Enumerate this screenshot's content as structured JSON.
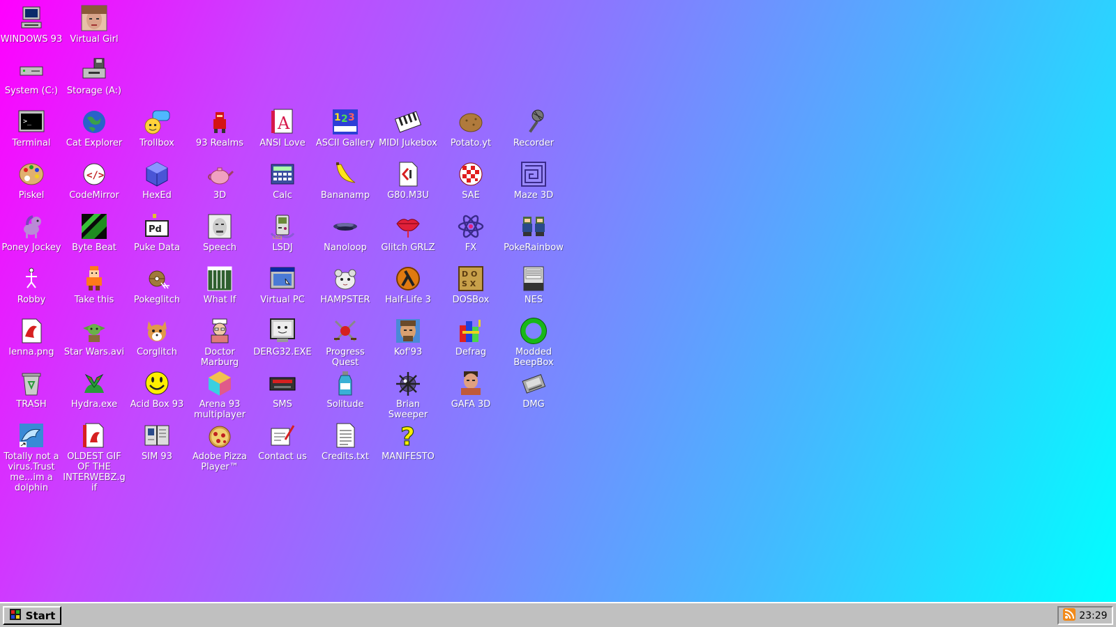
{
  "desktop": {
    "background_colors": [
      "#ff00ff",
      "#8a78ff",
      "#00ffff"
    ],
    "icons": [
      {
        "label": "WINDOWS 93",
        "icon": "computer-icon",
        "color": "#c0c0c0"
      },
      {
        "label": "Virtual Girl",
        "icon": "face-photo-icon",
        "color": "#d9a48a"
      },
      {
        "label": "System (C:)",
        "icon": "hard-drive-icon",
        "color": "#c0c0c0"
      },
      {
        "label": "Storage (A:)",
        "icon": "floppy-drive-icon",
        "color": "#c0c0c0"
      },
      {
        "label": "Terminal",
        "icon": "terminal-icon",
        "color": "#000000"
      },
      {
        "label": "Cat Explorer",
        "icon": "globe-icon",
        "color": "#2a62c9"
      },
      {
        "label": "Trollbox",
        "icon": "chat-bubble-icon",
        "color": "#4fb7ff"
      },
      {
        "label": "93 Realms",
        "icon": "knight-icon",
        "color": "#d41414"
      },
      {
        "label": "ANSI Love",
        "icon": "letter-a-icon",
        "color": "#d6194b"
      },
      {
        "label": "ASCII Gallery",
        "icon": "numbers-icon",
        "color": "#2d3fd6"
      },
      {
        "label": "MIDI Jukebox",
        "icon": "piano-keys-icon",
        "color": "#222222"
      },
      {
        "label": "Potato.yt",
        "icon": "potato-icon",
        "color": "#b07a3c"
      },
      {
        "label": "Recorder",
        "icon": "microphone-icon",
        "color": "#555555"
      },
      {
        "label": "Piskel",
        "icon": "palette-icon",
        "color": "#e0b070"
      },
      {
        "label": "CodeMirror",
        "icon": "code-editor-icon",
        "color": "#ffffff"
      },
      {
        "label": "HexEd",
        "icon": "cube-icon",
        "color": "#4a55d6"
      },
      {
        "label": "3D",
        "icon": "teapot-icon",
        "color": "#f0a0c0"
      },
      {
        "label": "Calc",
        "icon": "calculator-icon",
        "color": "#3a4fa0"
      },
      {
        "label": "Bananamp",
        "icon": "banana-icon",
        "color": "#ffe31a"
      },
      {
        "label": "G80.M3U",
        "icon": "playlist-file-icon",
        "color": "#ffffff"
      },
      {
        "label": "SAE",
        "icon": "checkered-ball-icon",
        "color": "#e01c1c"
      },
      {
        "label": "Maze 3D",
        "icon": "maze-icon",
        "color": "#6a4ad6"
      },
      {
        "label": "Poney Jockey",
        "icon": "pony-icon",
        "color": "#b98ad6"
      },
      {
        "label": "Byte Beat",
        "icon": "wave-icon",
        "color": "#1f8c1f"
      },
      {
        "label": "Puke Data",
        "icon": "pd-icon",
        "color": "#ffffff"
      },
      {
        "label": "Speech",
        "icon": "face-speech-icon",
        "color": "#dddddd"
      },
      {
        "label": "LSDJ",
        "icon": "gameboy-icon",
        "color": "#8a5ad6"
      },
      {
        "label": "Nanoloop",
        "icon": "disc-icon",
        "color": "#3a3a6a"
      },
      {
        "label": "Glitch GRLZ",
        "icon": "lips-icon",
        "color": "#e0203a"
      },
      {
        "label": "FX",
        "icon": "atom-icon",
        "color": "#3a2a8a"
      },
      {
        "label": "PokeRainbow",
        "icon": "pixel-characters-icon",
        "color": "#4a6a3a"
      },
      {
        "label": "Robby",
        "icon": "robot-icon",
        "color": "#ffffff"
      },
      {
        "label": "Take this",
        "icon": "character-icon",
        "color": "#ff7a1a"
      },
      {
        "label": "Pokeglitch",
        "icon": "pokeball-glitch-icon",
        "color": "#a07a3a"
      },
      {
        "label": "What If",
        "icon": "game-grid-icon",
        "color": "#2f5f2f"
      },
      {
        "label": "Virtual PC",
        "icon": "window-icon",
        "color": "#4a7ad6"
      },
      {
        "label": "HAMPSTER",
        "icon": "hamster-icon",
        "color": "#dddddd"
      },
      {
        "label": "Half-Life 3",
        "icon": "lambda-icon",
        "color": "#e07a10"
      },
      {
        "label": "DOSBox",
        "icon": "dosbox-icon",
        "color": "#c8a04a"
      },
      {
        "label": "NES",
        "icon": "nes-console-icon",
        "color": "#dddddd"
      },
      {
        "label": "lenna.png",
        "icon": "image-file-icon",
        "color": "#d62020"
      },
      {
        "label": "Star Wars.avi",
        "icon": "yoda-icon",
        "color": "#5aa03a"
      },
      {
        "label": "Corglitch",
        "icon": "corgi-icon",
        "color": "#e09a4a"
      },
      {
        "label": "Doctor Marburg",
        "icon": "doctor-icon",
        "color": "#e07a7a"
      },
      {
        "label": "DERG32.EXE",
        "icon": "monitor-face-icon",
        "color": "#cccccc"
      },
      {
        "label": "Progress Quest",
        "icon": "crossed-swords-icon",
        "color": "#d62020"
      },
      {
        "label": "Kof'93",
        "icon": "fighter-portrait-icon",
        "color": "#4a8ad6"
      },
      {
        "label": "Defrag",
        "icon": "defrag-icon",
        "color": "#4ad64a"
      },
      {
        "label": "Modded BeepBox",
        "icon": "ring-icon",
        "color": "#18b818"
      },
      {
        "label": "TRASH",
        "icon": "trash-icon",
        "color": "#cccccc"
      },
      {
        "label": "Hydra.exe",
        "icon": "hydra-icon",
        "color": "#2a9a3a"
      },
      {
        "label": "Acid Box 93",
        "icon": "smiley-icon",
        "color": "#ffee00"
      },
      {
        "label": "Arena 93 multiplayer",
        "icon": "colored-cube-icon",
        "color": "#e05a8a"
      },
      {
        "label": "SMS",
        "icon": "console-cartridge-icon",
        "color": "#333333"
      },
      {
        "label": "Solitude",
        "icon": "bottle-icon",
        "color": "#3ab0d6"
      },
      {
        "label": "Brian Sweeper",
        "icon": "mine-icon",
        "color": "#5a4a8a"
      },
      {
        "label": "GAFA 3D",
        "icon": "man-portrait-icon",
        "color": "#c05a3a"
      },
      {
        "label": "DMG",
        "icon": "gameboy-cartridge-icon",
        "color": "#aaaaaa"
      },
      {
        "label": "Totally not a virus.Trust me...im a dolphin",
        "icon": "dolphin-icon",
        "color": "#3a8ad6"
      },
      {
        "label": "OLDEST GIF OF THE INTERWEBZ.gif",
        "icon": "gif-file-icon",
        "color": "#d62020"
      },
      {
        "label": "SIM 93",
        "icon": "book-icon",
        "color": "#dddddd"
      },
      {
        "label": "Adobe Pizza Player™",
        "icon": "pizza-icon",
        "color": "#d6a04a"
      },
      {
        "label": "Contact us",
        "icon": "letter-icon",
        "color": "#ffffff"
      },
      {
        "label": "Credits.txt",
        "icon": "text-file-icon",
        "color": "#ffffff"
      },
      {
        "label": "MANIFESTO",
        "icon": "question-mark-icon",
        "color": "#ffee00"
      }
    ]
  },
  "taskbar": {
    "start_label": "Start",
    "clock": "23:29",
    "tray_icon": "rss-icon",
    "start_icon": "windows-logo-icon"
  }
}
